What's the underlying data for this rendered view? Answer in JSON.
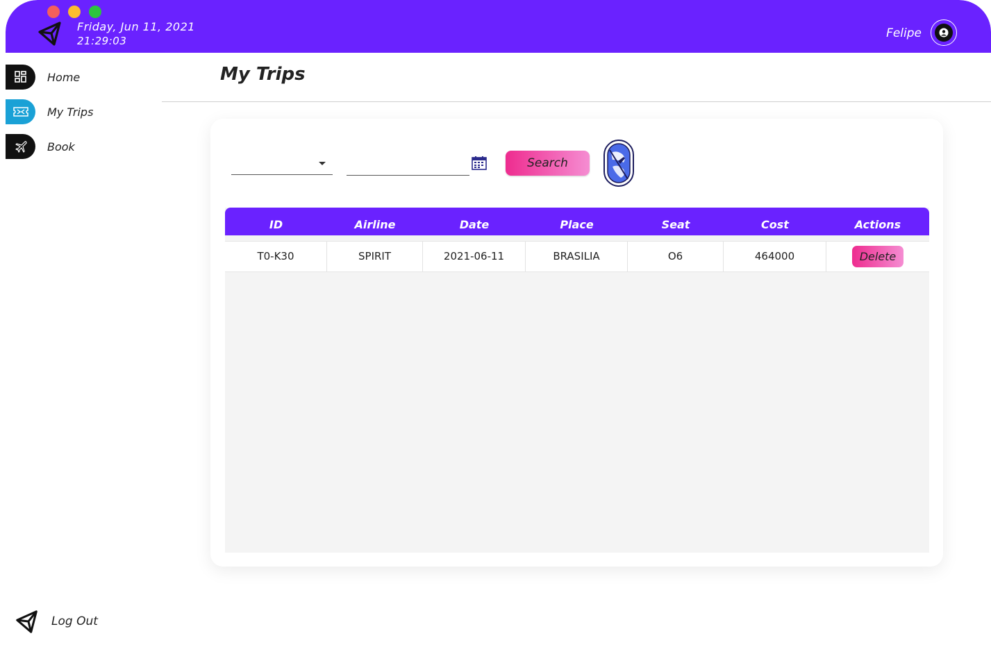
{
  "header": {
    "date": "Friday, Jun 11, 2021",
    "time": "21:29:03",
    "username": "Felipe"
  },
  "sidebar": {
    "items": [
      {
        "label": "Home",
        "icon": "dashboard-icon",
        "color": "#111111"
      },
      {
        "label": "My Trips",
        "icon": "ticket-icon",
        "color": "#1aa1d6"
      },
      {
        "label": "Book",
        "icon": "airplane-icon",
        "color": "#111111"
      }
    ],
    "logout_label": "Log Out"
  },
  "main": {
    "title": "My Trips",
    "search_label": "Search",
    "table": {
      "columns": [
        "ID",
        "Airline",
        "Date",
        "Place",
        "Seat",
        "Cost",
        "Actions"
      ],
      "rows": [
        {
          "id": "T0-K30",
          "airline": "SPIRIT",
          "date": "2021-06-11",
          "place": "BRASILIA",
          "seat": "O6",
          "cost": "464000",
          "action": "Delete"
        }
      ]
    }
  },
  "colors": {
    "header": "#6a22ff",
    "accent_pink": "#ee2c8f",
    "active_nav": "#1aa1d6"
  }
}
